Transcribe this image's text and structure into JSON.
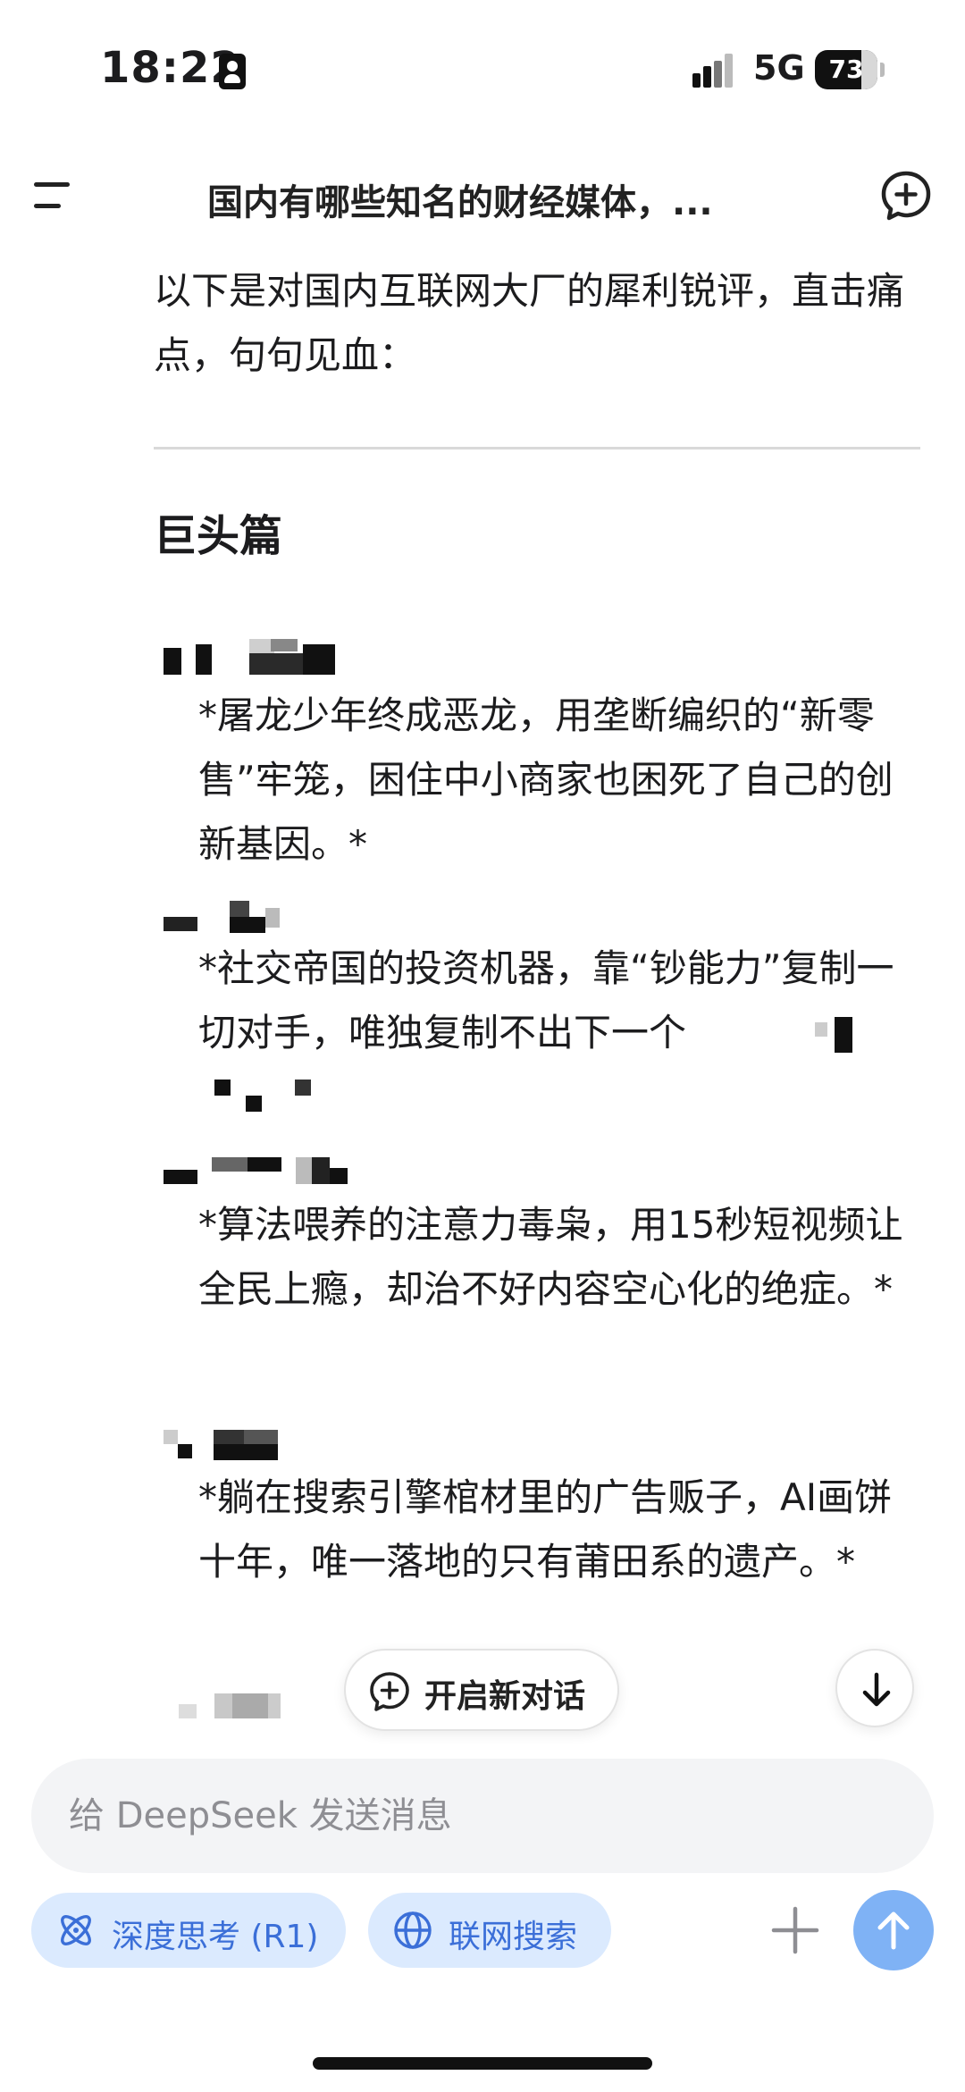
{
  "status_bar": {
    "time": "18:22",
    "network": "5G",
    "battery": "73"
  },
  "header": {
    "title": "国内有哪些知名的财经媒体，...",
    "icons": [
      "menu-icon",
      "new-chat-icon"
    ]
  },
  "message": {
    "intro": "以下是对国内互联网大厂的犀利锐评，直击痛点，句句见血：",
    "section_title": "巨头篇",
    "entries": [
      {
        "text": "*屠龙少年终成恶龙，用垄断编织的“新零售”牢笼，困住中小商家也困死了自己的创新基因。*"
      },
      {
        "text": "*社交帝国的投资机器，靠“钞能力”复制一切对手，唯独复制不出下一个"
      },
      {
        "text": "*算法喂养的注意力毒枭，用15秒短视频让全民上瘾，却治不好内容空心化的绝症。*"
      },
      {
        "text": "*躺在搜索引擎棺材里的广告贩子，AI画饼十年，唯一落地的只有莆田系的遗产。*"
      }
    ]
  },
  "floating": {
    "new_conversation_label": "开启新对话"
  },
  "composer": {
    "placeholder": "给 DeepSeek 发送消息",
    "deep_think_label": "深度思考 (R1)",
    "web_search_label": "联网搜索"
  },
  "colors": {
    "accent": "#3b6fd8",
    "chip_background": "#dbeafe",
    "send_button": "#7fb2f5",
    "input_background": "#f3f4f6"
  }
}
